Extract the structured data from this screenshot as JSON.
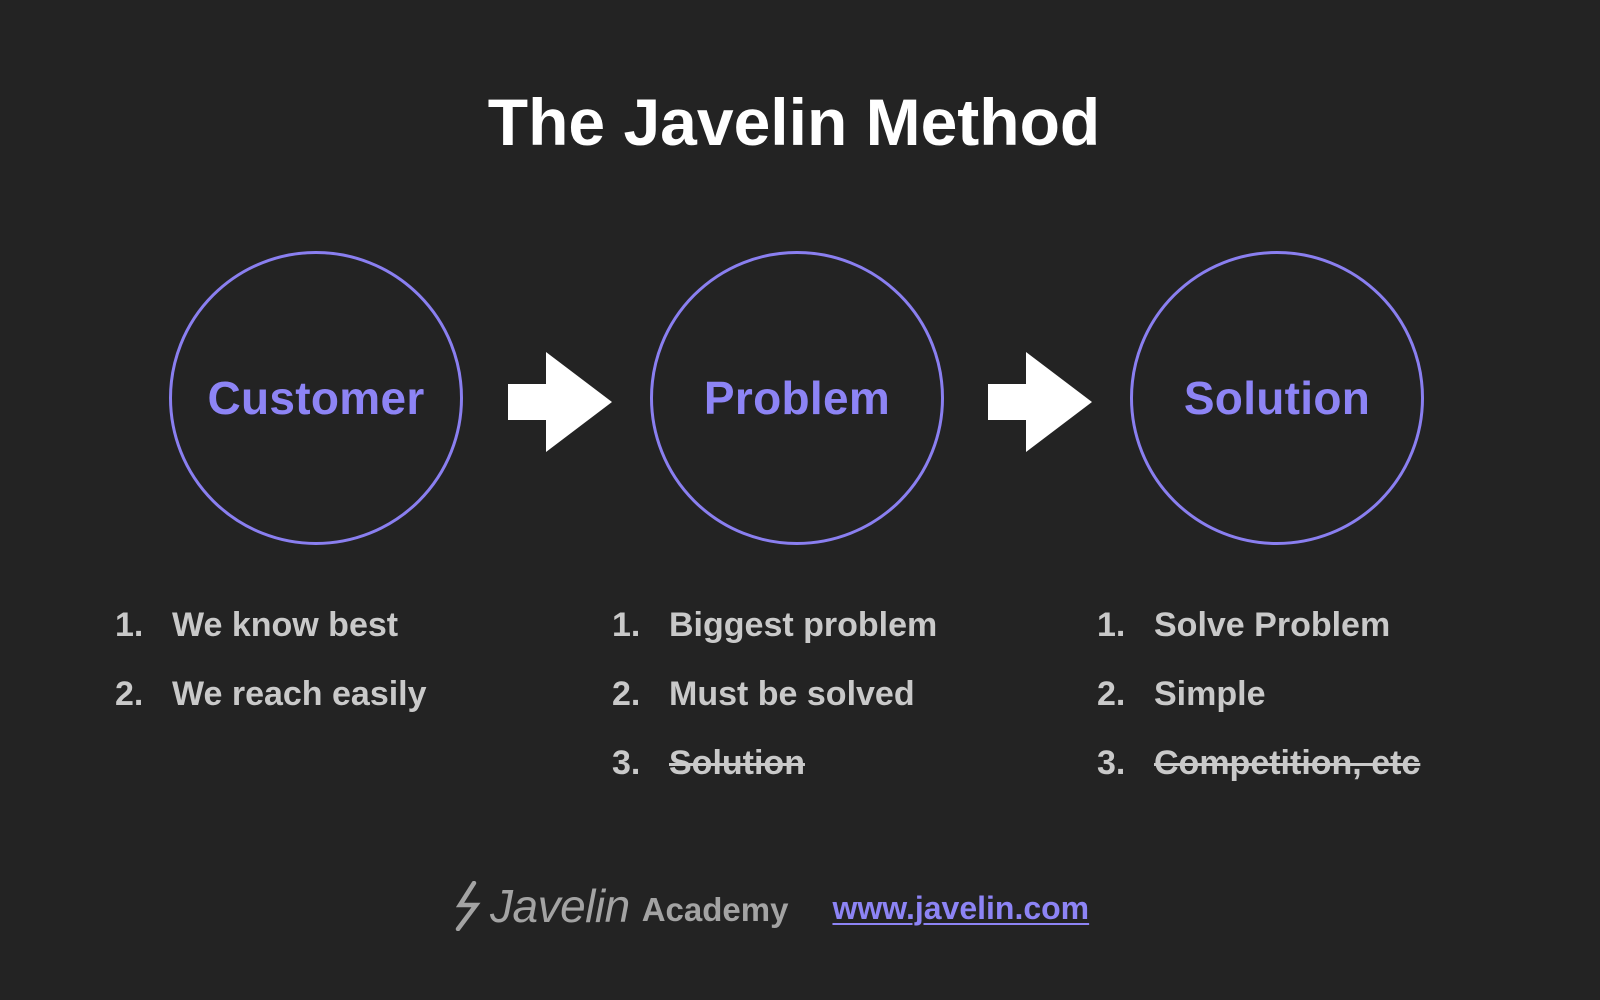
{
  "title": "The Javelin Method",
  "colors": {
    "background": "#232323",
    "accent": "#8d84f5",
    "circle_stroke": "#8a7ff0",
    "text": "#c9c9c9",
    "title": "#ffffff",
    "arrow": "#ffffff"
  },
  "stages": [
    {
      "label": "Customer",
      "items": [
        {
          "num": "1.",
          "text": "We know best",
          "struck": false
        },
        {
          "num": "2.",
          "text": "We reach easily",
          "struck": false
        }
      ]
    },
    {
      "label": "Problem",
      "items": [
        {
          "num": "1.",
          "text": "Biggest problem",
          "struck": false
        },
        {
          "num": "2.",
          "text": "Must be solved",
          "struck": false
        },
        {
          "num": "3.",
          "text": "Solution",
          "struck": true
        }
      ]
    },
    {
      "label": "Solution",
      "items": [
        {
          "num": "1.",
          "text": "Solve Problem",
          "struck": false
        },
        {
          "num": "2.",
          "text": "Simple",
          "struck": false
        },
        {
          "num": "3.",
          "text": "Competition, etc",
          "struck": true
        }
      ]
    }
  ],
  "arrows": [
    {
      "icon": "right-arrow-icon"
    },
    {
      "icon": "right-arrow-icon"
    }
  ],
  "footer": {
    "logo_icon": "lightning-bolt-icon",
    "brand_name": "Javelin",
    "brand_sub": "Academy",
    "link_text": "www.javelin.com"
  }
}
